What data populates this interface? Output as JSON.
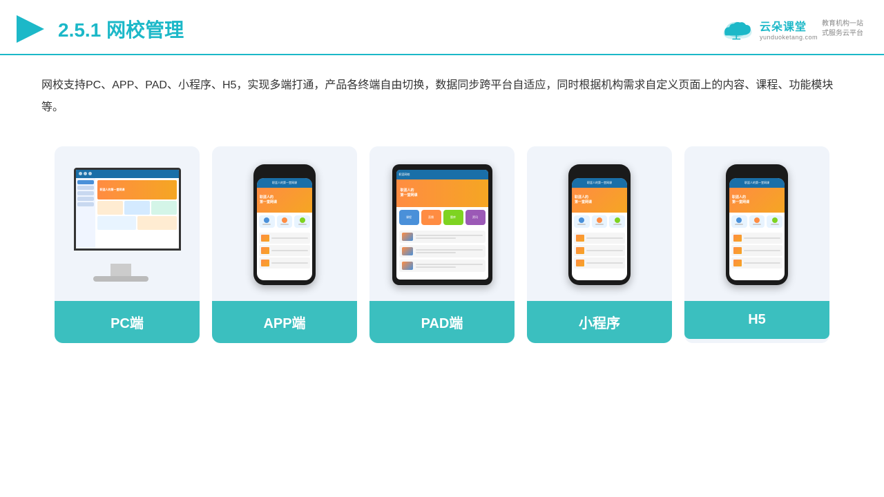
{
  "header": {
    "title_prefix": "2.5.1",
    "title_main": "网校管理",
    "logo": {
      "name_cn": "云朵课堂",
      "name_en": "yunduoketang.com",
      "tagline_line1": "教育机构一站",
      "tagline_line2": "式服务云平台"
    }
  },
  "description": {
    "text": "网校支持PC、APP、PAD、小程序、H5，实现多端打通，产品各终端自由切换，数据同步跨平台自适应，同时根据机构需求自定义页面上的内容、课程、功能模块等。"
  },
  "cards": [
    {
      "id": "pc",
      "label": "PC端"
    },
    {
      "id": "app",
      "label": "APP端"
    },
    {
      "id": "pad",
      "label": "PAD端"
    },
    {
      "id": "miniprogram",
      "label": "小程序"
    },
    {
      "id": "h5",
      "label": "H5"
    }
  ],
  "colors": {
    "accent": "#1cb8c8",
    "card_label_bg": "#3bbfbf",
    "header_line": "#1cb8c8"
  }
}
